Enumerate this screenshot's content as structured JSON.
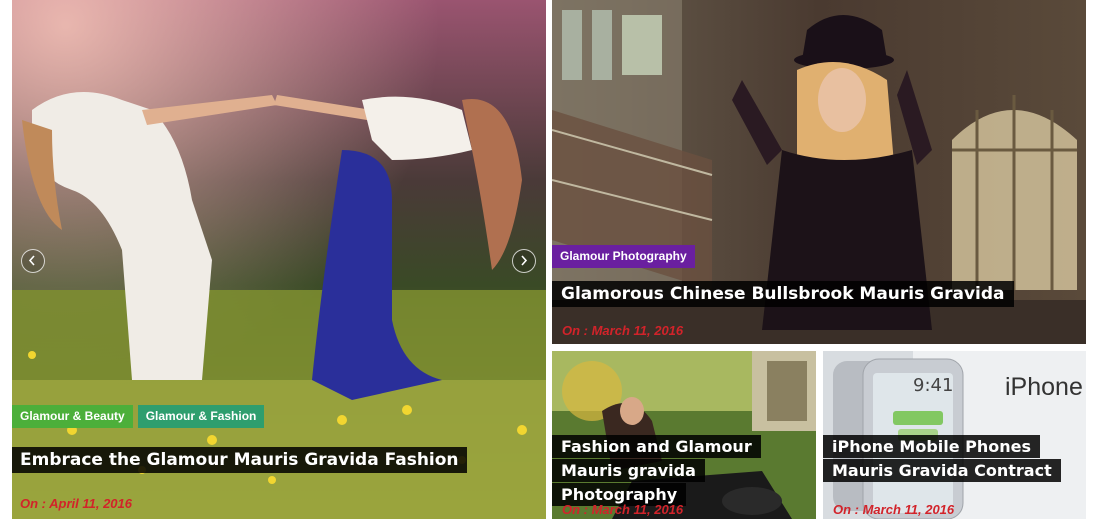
{
  "slider": {
    "prev_icon": "chevron-left-icon",
    "next_icon": "chevron-right-icon"
  },
  "posts": [
    {
      "categories": [
        {
          "label": "Glamour & Beauty",
          "color": "#4caf3a"
        },
        {
          "label": "Glamour & Fashion",
          "color": "#2e9e6e"
        }
      ],
      "title": "Embrace the Glamour Mauris Gravida Fashion",
      "date": "On : April 11, 2016"
    },
    {
      "categories": [
        {
          "label": "Glamour Photography",
          "color": "#6a1fa0"
        }
      ],
      "title": "Glamorous Chinese Bullsbrook Mauris Gravida",
      "date": "On : March 11, 2016"
    },
    {
      "categories": [],
      "title": "Fashion and Glamour Mauris gravida Photography",
      "date": "On : March 11, 2016"
    },
    {
      "categories": [],
      "title": "iPhone Mobile Phones Mauris Gravida Contract",
      "date": "On : March 11, 2016",
      "image_text": "iPhone",
      "phone_time": "9:41"
    }
  ]
}
